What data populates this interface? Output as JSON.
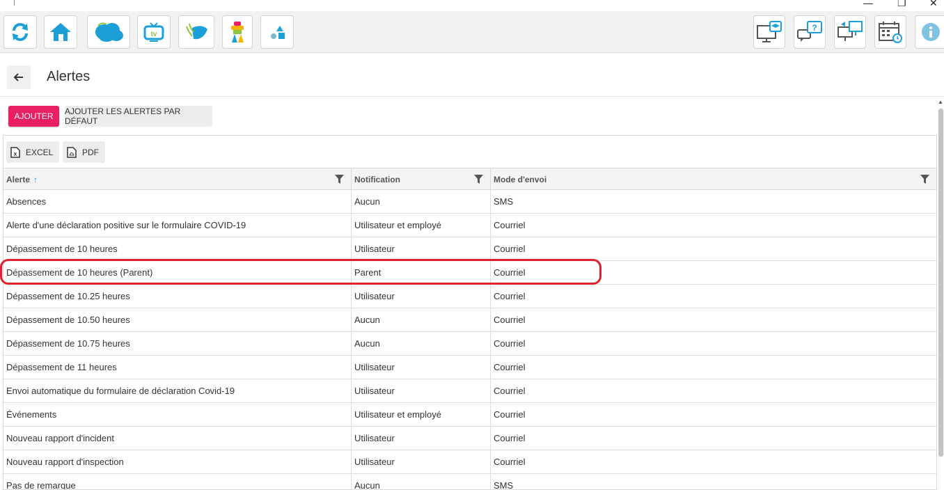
{
  "window": {
    "minimize": "—",
    "restore": "❐",
    "close": "✕"
  },
  "toolbar": {
    "left_icons": [
      "refresh-icon",
      "home-icon",
      "cloud-logo-icon",
      "tv-icon",
      "leaf-logo-icon",
      "mascot-icon",
      "shapes-icon"
    ],
    "right_icons": [
      "training-monitor-icon",
      "help-chat-icon",
      "remote-desktop-icon",
      "calendar-clock-icon",
      "info-icon"
    ],
    "accent": "#1a9fd8"
  },
  "header": {
    "title": "Alertes"
  },
  "actions": {
    "add_label": "AJOUTER",
    "defaults_label": "AJOUTER LES ALERTES PAR DÉFAUT"
  },
  "export": {
    "excel_label": "EXCEL",
    "pdf_label": "PDF"
  },
  "table": {
    "columns": [
      "Alerte",
      "Notification",
      "Mode d'envoi"
    ],
    "sorted_column": "Alerte",
    "sort_direction": "ascending",
    "rows": [
      [
        "Absences",
        "Aucun",
        "SMS"
      ],
      [
        "Alerte d'une déclaration positive sur le formulaire COVID-19",
        "Utilisateur et employé",
        "Courriel"
      ],
      [
        "Dépassement de 10 heures",
        "Utilisateur",
        "Courriel"
      ],
      [
        "Dépassement de 10 heures (Parent)",
        "Parent",
        "Courriel"
      ],
      [
        "Dépassement de 10.25 heures",
        "Utilisateur",
        "Courriel"
      ],
      [
        "Dépassement de 10.50 heures",
        "Aucun",
        "Courriel"
      ],
      [
        "Dépassement de 10.75 heures",
        "Aucun",
        "Courriel"
      ],
      [
        "Dépassement de 11 heures",
        "Utilisateur",
        "Courriel"
      ],
      [
        "Envoi automatique du formulaire de déclaration Covid-19",
        "Utilisateur",
        "Courriel"
      ],
      [
        "Événements",
        "Utilisateur et employé",
        "Courriel"
      ],
      [
        "Nouveau rapport d'incident",
        "Utilisateur",
        "Courriel"
      ],
      [
        "Nouveau rapport d'inspection",
        "Utilisateur",
        "Courriel"
      ],
      [
        "Pas de remarque",
        "Aucun",
        "SMS"
      ]
    ],
    "highlighted_row": "Dépassement de 10 heures (Parent)"
  },
  "colors": {
    "add_button": "#e91e63",
    "highlight": "#e0202e",
    "sort_arrow": "#1e88e5"
  }
}
